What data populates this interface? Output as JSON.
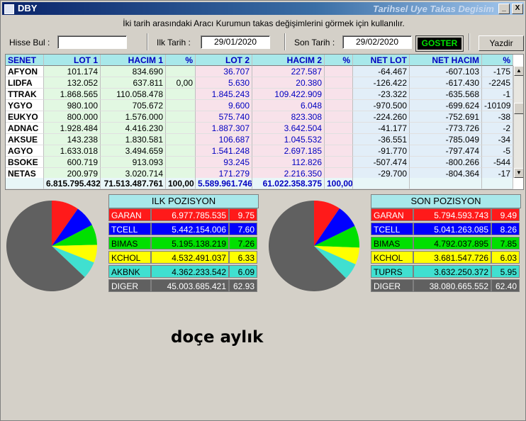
{
  "window": {
    "title": "DBY",
    "title_right": "Tarihsel Uye Takas Degisim",
    "minimize": "_",
    "maximize": "□",
    "close": "X"
  },
  "info_text": "İki tarih arasındaki  Aracı Kurumun takas değişimlerini görmek için kullanılır.",
  "toolbar": {
    "hisse_label": "Hisse Bul :",
    "hisse_value": "",
    "ilk_label": "Ilk Tarih :",
    "ilk_value": "29/01/2020",
    "son_label": "Son Tarih :",
    "son_value": "29/02/2020",
    "goster_label": "GOSTER",
    "yazdir_label": "Yazdir"
  },
  "table": {
    "headers": [
      "SENET",
      "LOT 1",
      "HACIM 1",
      "%",
      "LOT 2",
      "HACIM 2",
      "%",
      "NET LOT",
      "NET HACIM",
      "%"
    ],
    "rows": [
      [
        "AFYON",
        "101.174",
        "834.690",
        "",
        "36.707",
        "227.587",
        "",
        "-64.467",
        "-607.103",
        "-175"
      ],
      [
        "LIDFA",
        "132.052",
        "637.811",
        "0,00",
        "5.630",
        "20.380",
        "",
        "-126.422",
        "-617.430",
        "-2245"
      ],
      [
        "TTRAK",
        "1.868.565",
        "110.058.478",
        "",
        "1.845.243",
        "109.422.909",
        "",
        "-23.322",
        "-635.568",
        "-1"
      ],
      [
        "YGYO",
        "980.100",
        "705.672",
        "",
        "9.600",
        "6.048",
        "",
        "-970.500",
        "-699.624",
        "-10109"
      ],
      [
        "EUKYO",
        "800.000",
        "1.576.000",
        "",
        "575.740",
        "823.308",
        "",
        "-224.260",
        "-752.691",
        "-38"
      ],
      [
        "ADNAC",
        "1.928.484",
        "4.416.230",
        "",
        "1.887.307",
        "3.642.504",
        "",
        "-41.177",
        "-773.726",
        "-2"
      ],
      [
        "AKSUE",
        "143.238",
        "1.830.581",
        "",
        "106.687",
        "1.045.532",
        "",
        "-36.551",
        "-785.049",
        "-34"
      ],
      [
        "AGYO",
        "1.633.018",
        "3.494.659",
        "",
        "1.541.248",
        "2.697.185",
        "",
        "-91.770",
        "-797.474",
        "-5"
      ],
      [
        "BSOKE",
        "600.719",
        "913.093",
        "",
        "93.245",
        "112.826",
        "",
        "-507.474",
        "-800.266",
        "-544"
      ],
      [
        "NETAS",
        "200.979",
        "3.020.714",
        "",
        "171.279",
        "2.216.350",
        "",
        "-29.700",
        "-804.364",
        "-17"
      ]
    ],
    "totals": [
      "",
      "6.815.795.432",
      "71.513.487.761",
      "100,00",
      "5.589.961.746",
      "61.022.358.375",
      "100,00",
      "",
      "",
      ""
    ]
  },
  "scroll": {
    "up": "▲",
    "down": "▼"
  },
  "ilk_pozisyon": {
    "title": "ILK POZISYON",
    "rows": [
      {
        "name": "GARAN",
        "value": "6.977.785.535",
        "pct": "9.75",
        "bg": "#ff1a1a",
        "fg": "#ffffff"
      },
      {
        "name": "TCELL",
        "value": "5.442.154.006",
        "pct": "7.60",
        "bg": "#0000ff",
        "fg": "#ffffff"
      },
      {
        "name": "BIMAS",
        "value": "5.195.138.219",
        "pct": "7.26",
        "bg": "#00e000",
        "fg": "#000000"
      },
      {
        "name": "KCHOL",
        "value": "4.532.491.037",
        "pct": "6.33",
        "bg": "#ffff00",
        "fg": "#000000"
      },
      {
        "name": "AKBNK",
        "value": "4.362.233.542",
        "pct": "6.09",
        "bg": "#40e0d0",
        "fg": "#000000"
      },
      {
        "name": "DIGER",
        "value": "45.003.685.421",
        "pct": "62.93",
        "bg": "#606060",
        "fg": "#ffffff"
      }
    ]
  },
  "son_pozisyon": {
    "title": "SON POZISYON",
    "rows": [
      {
        "name": "GARAN",
        "value": "5.794.593.743",
        "pct": "9.49",
        "bg": "#ff1a1a",
        "fg": "#ffffff"
      },
      {
        "name": "TCELL",
        "value": "5.041.263.085",
        "pct": "8.26",
        "bg": "#0000ff",
        "fg": "#ffffff"
      },
      {
        "name": "BIMAS",
        "value": "4.792.037.895",
        "pct": "7.85",
        "bg": "#00e000",
        "fg": "#000000"
      },
      {
        "name": "KCHOL",
        "value": "3.681.547.726",
        "pct": "6.03",
        "bg": "#ffff00",
        "fg": "#000000"
      },
      {
        "name": "TUPRS",
        "value": "3.632.250.372",
        "pct": "5.95",
        "bg": "#40e0d0",
        "fg": "#000000"
      },
      {
        "name": "DIGER",
        "value": "38.080.665.552",
        "pct": "62.40",
        "bg": "#606060",
        "fg": "#ffffff"
      }
    ]
  },
  "caption": "doçe aylık"
}
